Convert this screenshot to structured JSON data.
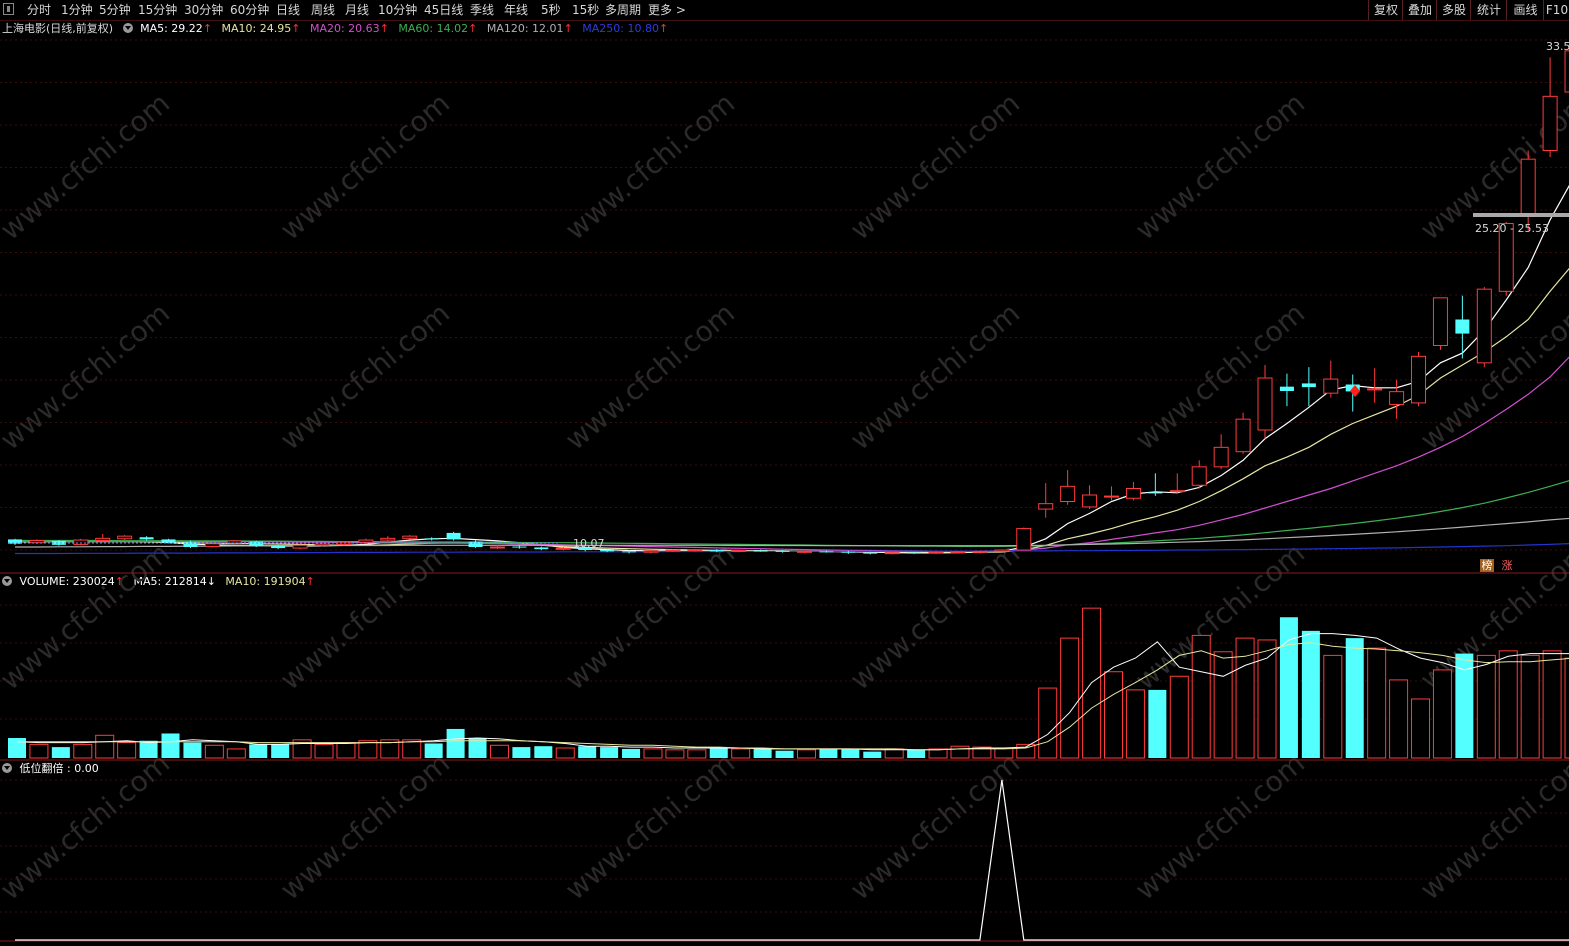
{
  "toolbar": {
    "periods": [
      "分时",
      "1分钟",
      "5分钟",
      "15分钟",
      "30分钟",
      "60分钟",
      "日线",
      "周线",
      "月线",
      "10分钟",
      "45日线",
      "季线",
      "年线",
      "5秒",
      "15秒",
      "多周期",
      "更多 >"
    ],
    "right_buttons": [
      "复权",
      "叠加",
      "多股",
      "统计",
      "画线",
      "F10"
    ]
  },
  "main_header": {
    "title": "上海电影(日线,前复权)",
    "ma5": "MA5: 29.22",
    "ma10": "MA10: 24.95",
    "ma20": "MA20: 20.63",
    "ma60": "MA60: 14.02",
    "ma120": "MA120: 12.01",
    "ma250": "MA250: 10.80",
    "up_arrow": "↑",
    "down_arrow": "↓"
  },
  "volume_header": {
    "volume": "VOLUME: 230024",
    "ma5": "MA5: 212814",
    "ma10": "MA10: 191904"
  },
  "indicator_header": {
    "label": "低位翻倍 : 0.00"
  },
  "annotations": {
    "high": "33.5",
    "range": "25.20 - 25.53",
    "low": "10.07",
    "tag1": "榜",
    "tag2": "涨"
  },
  "watermark": "www.cfchi.com",
  "colors": {
    "up": "#ff3b3b",
    "down": "#54ffff",
    "ma5": "#ffffff",
    "ma10": "#e6e6a0",
    "ma20": "#d050d0",
    "ma60": "#3cb050",
    "ma120": "#b0b0b0",
    "ma250": "#2233cc",
    "grid": "#3a0c0c"
  },
  "chart_data": [
    {
      "type": "candlestick",
      "title": "上海电影(日线,前复权)",
      "price_range": [
        10.0,
        34.0
      ],
      "candles": [
        [
          10.95,
          10.75,
          10.98,
          10.7
        ],
        [
          10.8,
          10.9,
          10.95,
          10.74
        ],
        [
          10.88,
          10.7,
          10.92,
          10.66
        ],
        [
          10.72,
          10.92,
          10.98,
          10.68
        ],
        [
          10.9,
          11.0,
          11.2,
          10.85
        ],
        [
          10.98,
          11.1,
          11.15,
          10.92
        ],
        [
          11.05,
          10.95,
          11.1,
          10.9
        ],
        [
          10.95,
          10.8,
          10.98,
          10.76
        ],
        [
          10.82,
          10.6,
          10.9,
          10.55
        ],
        [
          10.62,
          10.75,
          10.8,
          10.58
        ],
        [
          10.78,
          10.88,
          10.92,
          10.72
        ],
        [
          10.85,
          10.65,
          10.9,
          10.6
        ],
        [
          10.66,
          10.55,
          10.7,
          10.5
        ],
        [
          10.55,
          10.68,
          10.72,
          10.5
        ],
        [
          10.68,
          10.74,
          10.8,
          10.62
        ],
        [
          10.72,
          10.82,
          10.86,
          10.66
        ],
        [
          10.82,
          10.92,
          10.98,
          10.76
        ],
        [
          10.92,
          11.0,
          11.1,
          10.86
        ],
        [
          11.0,
          11.1,
          11.15,
          10.95
        ],
        [
          11.0,
          10.95,
          11.05,
          10.9
        ],
        [
          11.25,
          10.95,
          11.3,
          10.9
        ],
        [
          10.85,
          10.6,
          10.9,
          10.56
        ],
        [
          10.6,
          10.6,
          10.7,
          10.5
        ],
        [
          10.62,
          10.58,
          10.68,
          10.52
        ],
        [
          10.58,
          10.5,
          10.62,
          10.45
        ],
        [
          10.5,
          10.54,
          10.6,
          10.44
        ],
        [
          10.55,
          10.46,
          10.58,
          10.4
        ],
        [
          10.46,
          10.4,
          10.5,
          10.36
        ],
        [
          10.4,
          10.36,
          10.46,
          10.3
        ],
        [
          10.36,
          10.42,
          10.46,
          10.32
        ],
        [
          10.42,
          10.46,
          10.5,
          10.38
        ],
        [
          10.46,
          10.48,
          10.52,
          10.4
        ],
        [
          10.46,
          10.4,
          10.5,
          10.36
        ],
        [
          10.4,
          10.44,
          10.48,
          10.36
        ],
        [
          10.44,
          10.42,
          10.48,
          10.38
        ],
        [
          10.42,
          10.38,
          10.46,
          10.34
        ],
        [
          10.38,
          10.4,
          10.44,
          10.32
        ],
        [
          10.4,
          10.38,
          10.44,
          10.34
        ],
        [
          10.38,
          10.34,
          10.42,
          10.28
        ],
        [
          10.34,
          10.3,
          10.38,
          10.26
        ],
        [
          10.3,
          10.34,
          10.38,
          10.26
        ],
        [
          10.34,
          10.32,
          10.38,
          10.28
        ],
        [
          10.32,
          10.36,
          10.4,
          10.28
        ],
        [
          10.36,
          10.38,
          10.42,
          10.32
        ],
        [
          10.36,
          10.4,
          10.44,
          10.3
        ],
        [
          10.4,
          10.46,
          10.5,
          10.36
        ],
        [
          10.46,
          11.45,
          11.5,
          10.44
        ],
        [
          12.35,
          12.6,
          13.55,
          11.95
        ],
        [
          12.7,
          13.4,
          14.15,
          12.55
        ],
        [
          12.45,
          13.0,
          13.45,
          12.35
        ],
        [
          12.95,
          12.95,
          13.4,
          12.75
        ],
        [
          12.85,
          13.3,
          13.6,
          12.75
        ],
        [
          13.12,
          13.08,
          14.0,
          12.96
        ],
        [
          13.2,
          13.2,
          14.0,
          13.1
        ],
        [
          13.45,
          14.3,
          14.6,
          13.3
        ],
        [
          14.3,
          15.2,
          15.8,
          14.2
        ],
        [
          15.0,
          16.5,
          16.8,
          14.9
        ],
        [
          16.0,
          18.4,
          19.0,
          15.6
        ],
        [
          18.0,
          17.8,
          18.6,
          17.1
        ],
        [
          18.15,
          17.98,
          18.9,
          17.1
        ],
        [
          17.7,
          18.35,
          19.2,
          17.5
        ],
        [
          18.1,
          17.78,
          18.56,
          16.85
        ],
        [
          17.85,
          17.9,
          18.85,
          17.25
        ],
        [
          17.18,
          17.77,
          18.32,
          16.52
        ],
        [
          17.25,
          19.4,
          19.6,
          17.1
        ],
        [
          19.9,
          22.1,
          22.1,
          19.7
        ],
        [
          21.1,
          20.45,
          22.2,
          19.3
        ],
        [
          19.1,
          22.5,
          22.6,
          18.9
        ],
        [
          22.4,
          25.53,
          25.6,
          22.2
        ],
        [
          25.9,
          28.5,
          28.9,
          25.2
        ],
        [
          28.9,
          31.4,
          33.2,
          28.6
        ],
        [
          31.6,
          33.5,
          33.5,
          30.8
        ],
        [
          32.6,
          31.6,
          33.2,
          31.3
        ]
      ],
      "ma_lines": {
        "MA5": [
          10.84,
          10.85,
          10.86,
          10.87,
          10.86,
          10.87,
          10.85,
          10.8,
          10.74,
          10.7,
          10.68,
          10.66,
          10.65,
          10.64,
          10.65,
          10.68,
          10.72,
          10.82,
          10.92,
          10.98,
          11.0,
          10.94,
          10.88,
          10.8,
          10.7,
          10.58,
          10.52,
          10.48,
          10.44,
          10.42,
          10.42,
          10.43,
          10.44,
          10.44,
          10.43,
          10.42,
          10.4,
          10.39,
          10.38,
          10.36,
          10.34,
          10.33,
          10.33,
          10.34,
          10.36,
          10.4,
          10.6,
          10.98,
          11.68,
          12.15,
          12.7,
          13.05,
          13.15,
          13.1,
          13.35,
          13.9,
          14.6,
          15.6,
          16.3,
          17.05,
          17.85,
          18.05,
          17.95,
          17.95,
          18.25,
          19.1,
          19.55,
          20.6,
          22.0,
          23.5,
          25.7,
          27.5,
          29.22
        ],
        "MA10": [
          10.85,
          10.85,
          10.85,
          10.85,
          10.85,
          10.85,
          10.84,
          10.83,
          10.8,
          10.78,
          10.76,
          10.75,
          10.74,
          10.72,
          10.7,
          10.68,
          10.68,
          10.7,
          10.74,
          10.78,
          10.8,
          10.8,
          10.78,
          10.74,
          10.68,
          10.62,
          10.58,
          10.55,
          10.52,
          10.5,
          10.48,
          10.46,
          10.45,
          10.44,
          10.43,
          10.42,
          10.41,
          10.4,
          10.4,
          10.39,
          10.38,
          10.37,
          10.36,
          10.36,
          10.36,
          10.37,
          10.47,
          10.67,
          10.98,
          11.2,
          11.45,
          11.75,
          12.0,
          12.3,
          12.7,
          13.2,
          13.75,
          14.35,
          14.75,
          15.2,
          15.8,
          16.3,
          16.7,
          17.1,
          17.6,
          18.4,
          19.0,
          19.6,
          20.3,
          21.1,
          22.4,
          23.6,
          24.95
        ],
        "MA20": [
          10.86,
          10.86,
          10.86,
          10.86,
          10.86,
          10.86,
          10.86,
          10.86,
          10.86,
          10.85,
          10.85,
          10.84,
          10.84,
          10.83,
          10.82,
          10.81,
          10.8,
          10.79,
          10.78,
          10.78,
          10.78,
          10.77,
          10.76,
          10.74,
          10.72,
          10.7,
          10.68,
          10.66,
          10.64,
          10.62,
          10.6,
          10.58,
          10.56,
          10.54,
          10.52,
          10.5,
          10.48,
          10.46,
          10.45,
          10.44,
          10.43,
          10.42,
          10.41,
          10.41,
          10.41,
          10.42,
          10.46,
          10.55,
          10.7,
          10.8,
          10.95,
          11.1,
          11.25,
          11.4,
          11.6,
          11.85,
          12.1,
          12.4,
          12.7,
          13.0,
          13.3,
          13.65,
          14.0,
          14.35,
          14.75,
          15.2,
          15.7,
          16.3,
          16.95,
          17.65,
          18.45,
          19.5,
          20.63
        ],
        "MA60": [
          10.9,
          10.9,
          10.9,
          10.9,
          10.9,
          10.89,
          10.89,
          10.89,
          10.88,
          10.88,
          10.88,
          10.87,
          10.87,
          10.86,
          10.86,
          10.85,
          10.85,
          10.84,
          10.84,
          10.83,
          10.83,
          10.82,
          10.82,
          10.81,
          10.8,
          10.8,
          10.79,
          10.78,
          10.77,
          10.76,
          10.75,
          10.74,
          10.73,
          10.72,
          10.71,
          10.7,
          10.69,
          10.68,
          10.67,
          10.66,
          10.65,
          10.64,
          10.64,
          10.63,
          10.63,
          10.63,
          10.64,
          10.66,
          10.7,
          10.74,
          10.78,
          10.83,
          10.88,
          10.94,
          11.0,
          11.08,
          11.16,
          11.26,
          11.36,
          11.46,
          11.57,
          11.68,
          11.8,
          11.93,
          12.07,
          12.24,
          12.42,
          12.62,
          12.86,
          13.12,
          13.4,
          13.7,
          14.02
        ],
        "MA120": [
          10.6,
          10.6,
          10.61,
          10.61,
          10.62,
          10.62,
          10.63,
          10.63,
          10.64,
          10.64,
          10.65,
          10.65,
          10.66,
          10.66,
          10.66,
          10.67,
          10.67,
          10.67,
          10.68,
          10.68,
          10.68,
          10.68,
          10.68,
          10.68,
          10.68,
          10.68,
          10.68,
          10.68,
          10.68,
          10.68,
          10.68,
          10.68,
          10.68,
          10.67,
          10.67,
          10.67,
          10.67,
          10.66,
          10.66,
          10.66,
          10.66,
          10.66,
          10.66,
          10.66,
          10.66,
          10.66,
          10.67,
          10.68,
          10.7,
          10.72,
          10.74,
          10.76,
          10.79,
          10.82,
          10.85,
          10.89,
          10.93,
          10.98,
          11.03,
          11.08,
          11.13,
          11.18,
          11.24,
          11.3,
          11.37,
          11.44,
          11.52,
          11.6,
          11.68,
          11.76,
          11.85,
          11.93,
          12.01
        ],
        "MA250": [
          10.3,
          10.3,
          10.3,
          10.31,
          10.31,
          10.31,
          10.32,
          10.32,
          10.32,
          10.33,
          10.33,
          10.33,
          10.34,
          10.34,
          10.34,
          10.35,
          10.35,
          10.35,
          10.36,
          10.36,
          10.36,
          10.37,
          10.37,
          10.37,
          10.37,
          10.38,
          10.38,
          10.38,
          10.38,
          10.38,
          10.39,
          10.39,
          10.39,
          10.39,
          10.4,
          10.4,
          10.4,
          10.4,
          10.4,
          10.4,
          10.41,
          10.41,
          10.41,
          10.41,
          10.41,
          10.42,
          10.42,
          10.42,
          10.43,
          10.43,
          10.44,
          10.44,
          10.45,
          10.46,
          10.46,
          10.47,
          10.48,
          10.49,
          10.5,
          10.51,
          10.52,
          10.53,
          10.55,
          10.56,
          10.58,
          10.6,
          10.62,
          10.64,
          10.66,
          10.69,
          10.72,
          10.76,
          10.8
        ]
      }
    },
    {
      "type": "bar",
      "title": "VOLUME",
      "values": [
        22,
        15,
        12,
        15,
        25,
        17,
        19,
        27,
        17,
        14,
        10,
        15,
        15,
        20,
        15,
        17,
        19,
        20,
        20,
        16,
        32,
        22,
        14,
        12,
        13,
        11,
        13,
        12,
        10,
        10,
        9,
        9,
        12,
        10,
        10,
        8,
        9,
        10,
        10,
        7,
        10,
        9,
        10,
        13,
        12,
        11,
        15,
        77,
        132,
        165,
        95,
        75,
        75,
        90,
        135,
        117,
        132,
        130,
        155,
        140,
        113,
        132,
        121,
        86,
        65,
        97,
        115,
        113,
        118,
        113,
        118,
        110,
        150
      ],
      "ma5": [
        18,
        17,
        17,
        17,
        18,
        19,
        17,
        18,
        20,
        19,
        18,
        15,
        15,
        16,
        16,
        16,
        17,
        17,
        18,
        19,
        21,
        22,
        21,
        19,
        18,
        16,
        13,
        13,
        12,
        12,
        11,
        11,
        11,
        11,
        10,
        10,
        10,
        10,
        10,
        9,
        9,
        9,
        9,
        10,
        11,
        11,
        12,
        26,
        50,
        83,
        100,
        110,
        128,
        100,
        95,
        90,
        102,
        110,
        130,
        137,
        137,
        135,
        132,
        120,
        110,
        105,
        97,
        103,
        112,
        115,
        115,
        115,
        120
      ],
      "ma10": [
        18,
        18,
        18,
        18,
        18,
        18,
        18,
        18,
        18,
        18,
        18,
        17,
        17,
        17,
        17,
        17,
        17,
        17,
        18,
        18,
        19,
        19,
        19,
        19,
        18,
        17,
        16,
        15,
        14,
        14,
        13,
        12,
        12,
        11,
        11,
        10,
        10,
        10,
        10,
        10,
        10,
        9,
        9,
        10,
        10,
        10,
        11,
        18,
        34,
        55,
        70,
        83,
        97,
        113,
        118,
        110,
        112,
        118,
        125,
        127,
        123,
        121,
        120,
        118,
        116,
        113,
        108,
        105,
        106,
        106,
        108,
        110,
        112
      ],
      "vmax": 185
    },
    {
      "type": "line",
      "title": "低位翻倍",
      "values": [
        0,
        0,
        0,
        0,
        0,
        0,
        0,
        0,
        0,
        0,
        0,
        0,
        0,
        0,
        0,
        0,
        0,
        0,
        0,
        0,
        0,
        0,
        0,
        0,
        0,
        0,
        0,
        0,
        0,
        0,
        0,
        0,
        0,
        0,
        0,
        0,
        0,
        0,
        0,
        0,
        0,
        0,
        0,
        0,
        0,
        1,
        0,
        0,
        0,
        0,
        0,
        0,
        0,
        0,
        0,
        0,
        0,
        0,
        0,
        0,
        0,
        0,
        0,
        0,
        0,
        0,
        0,
        0,
        0,
        0,
        0,
        0,
        0
      ],
      "current": 0.0
    }
  ]
}
